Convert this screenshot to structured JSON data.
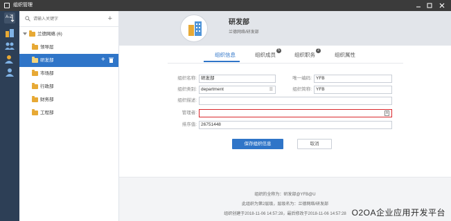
{
  "window": {
    "title": "组织管理",
    "icon": "window-app-icon"
  },
  "rail": {
    "items": [
      {
        "icon": "sort-az-icon",
        "label": "A-Z"
      },
      {
        "icon": "org-building-icon"
      },
      {
        "icon": "group-users-icon"
      },
      {
        "icon": "user-role-icon"
      },
      {
        "icon": "user-single-icon"
      }
    ]
  },
  "tree": {
    "search": {
      "placeholder": "请输入关键字",
      "value": ""
    },
    "root": {
      "label": "兰德网络 (6)"
    },
    "items": [
      {
        "label": "领导层",
        "selected": false
      },
      {
        "label": "研发部",
        "selected": true
      },
      {
        "label": "市场部",
        "selected": false
      },
      {
        "label": "行政部",
        "selected": false
      },
      {
        "label": "财务部",
        "selected": false
      },
      {
        "label": "工程部",
        "selected": false
      }
    ]
  },
  "header": {
    "name": "研发部",
    "path": "兰德网络/研发部"
  },
  "tabs": [
    {
      "label": "组织信息",
      "active": true,
      "badge": ""
    },
    {
      "label": "组织成员",
      "active": false,
      "badge": "5"
    },
    {
      "label": "组织职务",
      "active": false,
      "badge": "2"
    },
    {
      "label": "组织属性",
      "active": false,
      "badge": ""
    }
  ],
  "form": {
    "name_label": "组织名称:",
    "name_value": "研发部",
    "code_label": "唯一编码:",
    "code_value": "YFB",
    "type_label": "组织类别:",
    "type_value": "department",
    "short_label": "组织简称:",
    "short_value": "YFB",
    "desc_label": "组织描述:",
    "desc_value": "",
    "manager_label": "管理者:",
    "manager_value": "",
    "order_label": "排序值:",
    "order_value": "26751448"
  },
  "buttons": {
    "save": "保存组织信息",
    "cancel": "取消"
  },
  "footer": {
    "line1": "组织的全称为：研发部@YFB@U",
    "line2": "此组织为第2层级，层级名为：兰德网络/研发部",
    "line3": "组织创建于2018-11-06 14:57:28，最后修改于2018-11-06 14:57:28"
  },
  "watermark": "O2OA企业应用开发平台",
  "colors": {
    "accent": "#2f75c8",
    "rail": "#2d3f56",
    "error": "#d9262b",
    "folder": "#e7a935"
  }
}
